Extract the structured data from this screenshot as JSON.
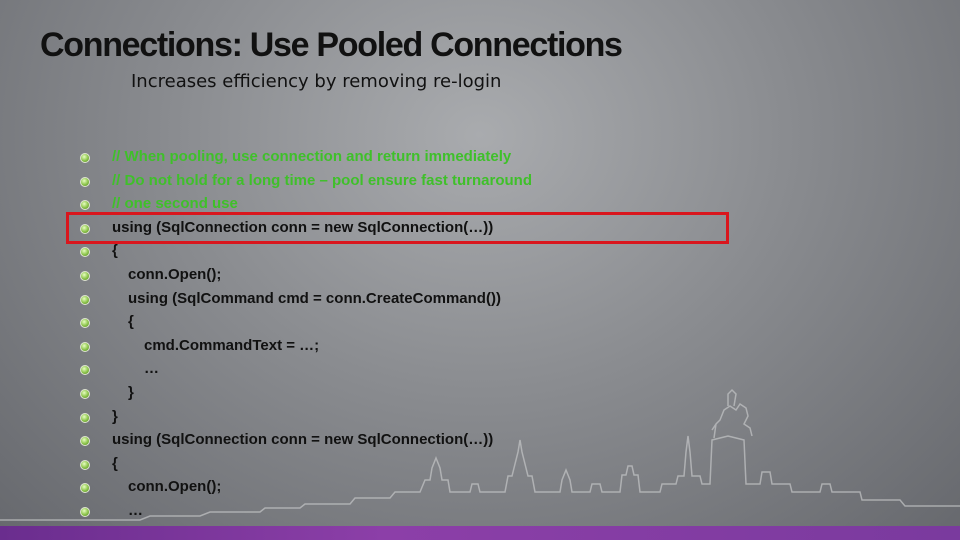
{
  "slide": {
    "title": "Connections: Use Pooled Connections",
    "subtitle": "Increases efficiency by removing re-login",
    "code_lines": [
      {
        "text": "// When pooling, use connection and return immediately",
        "indent": 0,
        "comment": true
      },
      {
        "text": "// Do not hold for a long time – pool ensure fast turnaround",
        "indent": 0,
        "comment": true
      },
      {
        "text": "// one second use",
        "indent": 0,
        "comment": true
      },
      {
        "text": "using (SqlConnection conn = new SqlConnection(…))",
        "indent": 0,
        "comment": false
      },
      {
        "text": "{",
        "indent": 0,
        "comment": false
      },
      {
        "text": "conn.Open();",
        "indent": 1,
        "comment": false
      },
      {
        "text": "using (SqlCommand cmd = conn.CreateCommand())",
        "indent": 1,
        "comment": false
      },
      {
        "text": "{",
        "indent": 1,
        "comment": false
      },
      {
        "text": "cmd.CommandText = …;",
        "indent": 2,
        "comment": false
      },
      {
        "text": "…",
        "indent": 2,
        "comment": false
      },
      {
        "text": "}",
        "indent": 1,
        "comment": false
      },
      {
        "text": "}",
        "indent": 0,
        "comment": false
      },
      {
        "text": "using (SqlConnection conn = new SqlConnection(…))",
        "indent": 0,
        "comment": false
      },
      {
        "text": "{",
        "indent": 0,
        "comment": false
      },
      {
        "text": "conn.Open();",
        "indent": 1,
        "comment": false
      },
      {
        "text": "…",
        "indent": 1,
        "comment": false
      }
    ],
    "highlighted_line": 3,
    "colors": {
      "comment": "#3fc02a",
      "code": "#111111",
      "highlight_border": "#d9161d",
      "accent_bar": "#7a3a9e"
    },
    "decoration": "city-skyline-with-horseman-statue"
  }
}
